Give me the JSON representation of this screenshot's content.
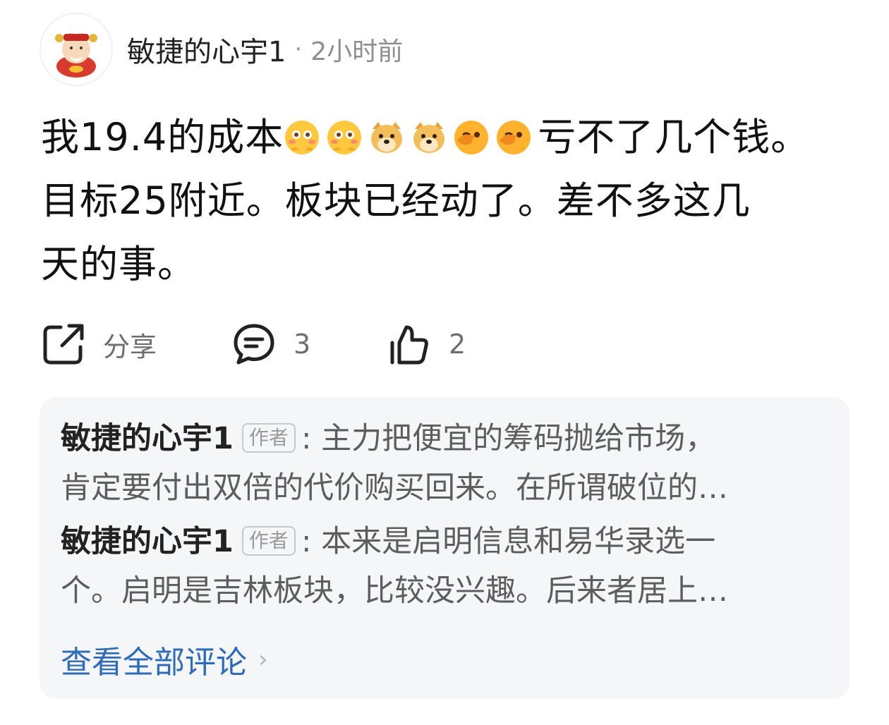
{
  "post": {
    "author": "敏捷的心宇1",
    "dot": "·",
    "time": "2小时前",
    "text_part1": "我19.4的成本",
    "text_part2": "亏不了几个钱。",
    "text_line2": "目标25附近。板块已经动了。差不多这几",
    "text_line3": "天的事。",
    "emojis": [
      "flushed-face",
      "flushed-face",
      "doge",
      "doge",
      "wink-face",
      "wink-face"
    ]
  },
  "actions": {
    "share_label": "分享",
    "comment_count": "3",
    "like_count": "2"
  },
  "comments": {
    "items": [
      {
        "author": "敏捷的心宇1",
        "tag": "作者",
        "colon": ":",
        "line1": "主力把便宜的筹码抛给市场，",
        "line2": "肯定要付出双倍的代价购买回来。在所谓破位的…"
      },
      {
        "author": "敏捷的心宇1",
        "tag": "作者",
        "colon": ":",
        "line1": "本来是启明信息和易华录选一",
        "line2": "个。启明是吉林板块，比较没兴趣。后来者居上…"
      }
    ],
    "view_all": "查看全部评论",
    "chevron": "›"
  },
  "colors": {
    "link": "#2e6bb8",
    "panel_bg": "#f5f6f7",
    "muted": "#8e8e8e"
  }
}
